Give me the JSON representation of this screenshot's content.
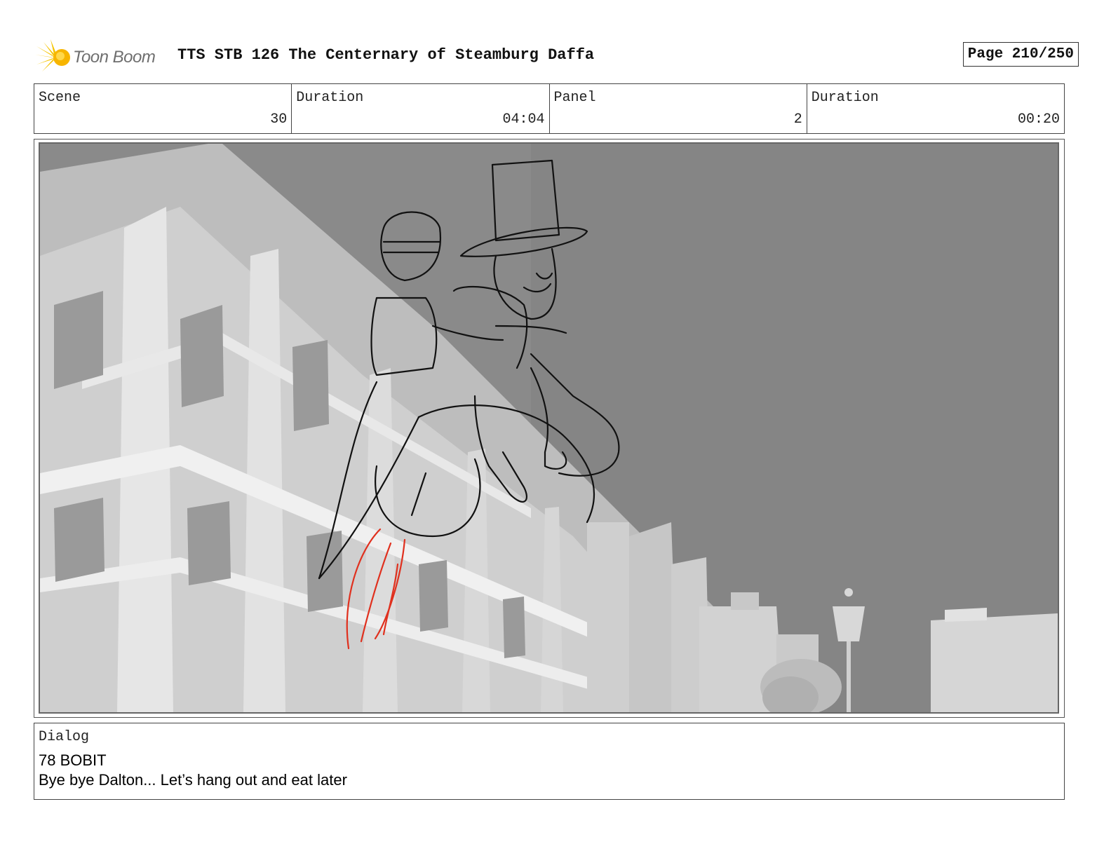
{
  "header": {
    "logo_text": "Toon Boom",
    "title": "TTS STB 126 The Centernary of Steamburg Daffa",
    "page": "Page 210/250"
  },
  "info": {
    "scene_label": "Scene",
    "scene_value": "30",
    "scene_duration_label": "Duration",
    "scene_duration_value": "04:04",
    "panel_label": "Panel",
    "panel_value": "2",
    "panel_duration_label": "Duration",
    "panel_duration_value": "00:20"
  },
  "dialog": {
    "label": "Dialog",
    "line1": "78 BOBIT",
    "line2": "Bye bye Dalton... Let’s hang out and eat later"
  },
  "colors": {
    "logo_accent": "#f5c400",
    "sketch_red": "#e0301e",
    "sky_gray": "#8a8a8a"
  }
}
